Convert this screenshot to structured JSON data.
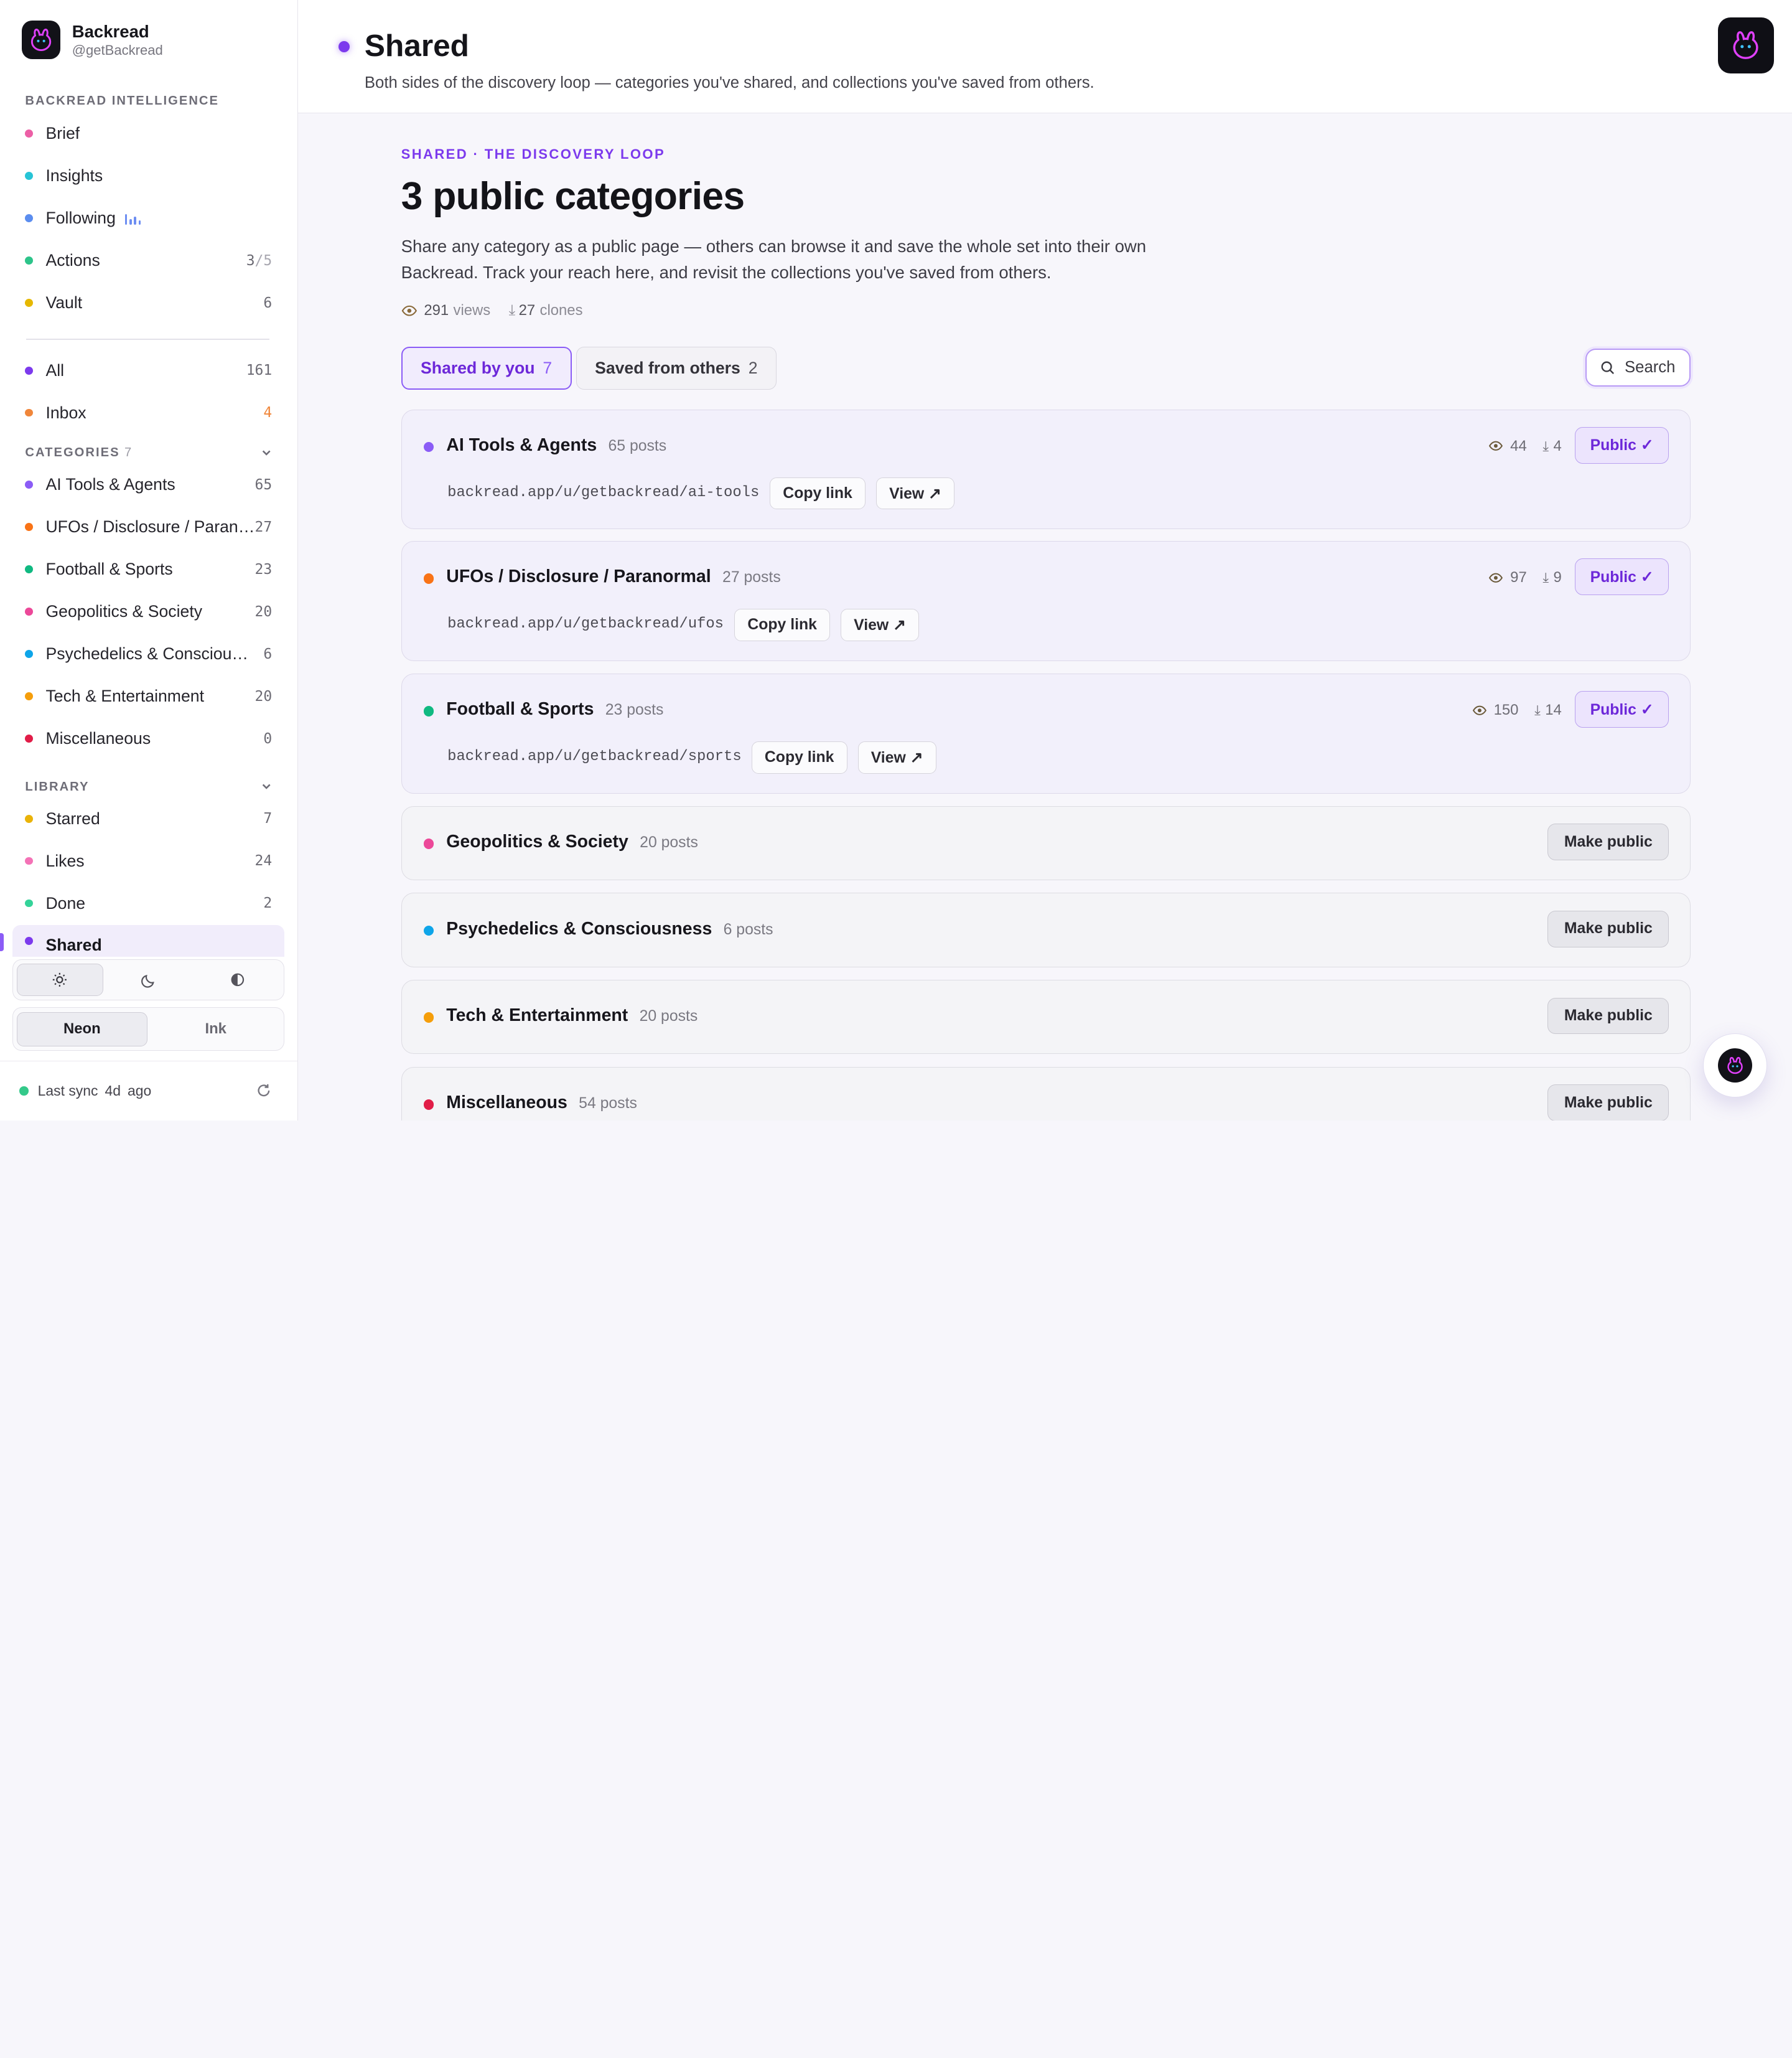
{
  "brand": {
    "name": "Backread",
    "handle": "@getBackread"
  },
  "sidebar": {
    "section_intelligence": "BACKREAD INTELLIGENCE",
    "intel_items": [
      {
        "label": "Brief",
        "color": "#ec5fa6"
      },
      {
        "label": "Insights",
        "color": "#27c4d6"
      },
      {
        "label": "Following",
        "color": "#5b8def"
      },
      {
        "label": "Actions",
        "color": "#2dc48a",
        "count": "3",
        "count_total": "/5"
      },
      {
        "label": "Vault",
        "color": "#e6b800",
        "count": "6"
      }
    ],
    "general_items": [
      {
        "label": "All",
        "color": "#7c3aed",
        "count": "161"
      },
      {
        "label": "Inbox",
        "color": "#f0863a",
        "count": "4",
        "count_color": "#f0863a"
      }
    ],
    "section_categories": "CATEGORIES",
    "categories_count": "7",
    "categories": [
      {
        "label": "AI Tools & Agents",
        "color": "#8b5cf6",
        "count": "65"
      },
      {
        "label": "UFOs / Disclosure / Paranormal",
        "color": "#f97316",
        "count": "27"
      },
      {
        "label": "Football & Sports",
        "color": "#10b981",
        "count": "23"
      },
      {
        "label": "Geopolitics & Society",
        "color": "#ec4899",
        "count": "20"
      },
      {
        "label": "Psychedelics & Consciousness",
        "color": "#0ea5e9",
        "count": "6"
      },
      {
        "label": "Tech & Entertainment",
        "color": "#f59e0b",
        "count": "20"
      },
      {
        "label": "Miscellaneous",
        "color": "#e11d48",
        "count": "0"
      }
    ],
    "section_library": "LIBRARY",
    "library": [
      {
        "label": "Starred",
        "color": "#eab308",
        "count": "7"
      },
      {
        "label": "Likes",
        "color": "#f472b6",
        "count": "24"
      },
      {
        "label": "Done",
        "color": "#34d399",
        "count": "2"
      },
      {
        "label": "Shared",
        "color": "#7c3aed",
        "count": ""
      }
    ],
    "theme_modes": [
      "light-icon",
      "moon-icon",
      "contrast-icon"
    ],
    "styles": [
      "Neon",
      "Ink"
    ],
    "sync": {
      "label": "Last sync",
      "value": "4d",
      "suffix": "ago"
    }
  },
  "header": {
    "title": "Shared",
    "subtitle": "Both sides of the discovery loop — categories you've shared, and collections you've saved from others."
  },
  "main": {
    "eyebrow": "SHARED · THE DISCOVERY LOOP",
    "hero": "3 public categories",
    "description": "Share any category as a public page — others can browse it and save the whole set into their own Backread. Track your reach here, and revisit the collections you've saved from others.",
    "views": "291",
    "views_label": "views",
    "clones": "27",
    "clones_label": "clones",
    "tabs": [
      {
        "label": "Shared by you",
        "count": "7"
      },
      {
        "label": "Saved from others",
        "count": "2"
      }
    ],
    "search_label": "Search",
    "copy_label": "Copy link",
    "view_label": "View ↗",
    "public_label": "Public ✓",
    "make_public_label": "Make public",
    "public_cards": [
      {
        "name": "AI Tools & Agents",
        "posts": "65 posts",
        "color": "#8b5cf6",
        "url": "backread.app/u/getbackread/ai-tools",
        "views": "44",
        "clones": "4"
      },
      {
        "name": "UFOs / Disclosure / Paranormal",
        "posts": "27 posts",
        "color": "#f97316",
        "url": "backread.app/u/getbackread/ufos",
        "views": "97",
        "clones": "9"
      },
      {
        "name": "Football & Sports",
        "posts": "23 posts",
        "color": "#10b981",
        "url": "backread.app/u/getbackread/sports",
        "views": "150",
        "clones": "14"
      }
    ],
    "private_cards": [
      {
        "name": "Geopolitics & Society",
        "posts": "20 posts",
        "color": "#ec4899"
      },
      {
        "name": "Psychedelics & Consciousness",
        "posts": "6 posts",
        "color": "#0ea5e9"
      },
      {
        "name": "Tech & Entertainment",
        "posts": "20 posts",
        "color": "#f59e0b"
      },
      {
        "name": "Miscellaneous",
        "posts": "54 posts",
        "color": "#e11d48"
      }
    ]
  }
}
